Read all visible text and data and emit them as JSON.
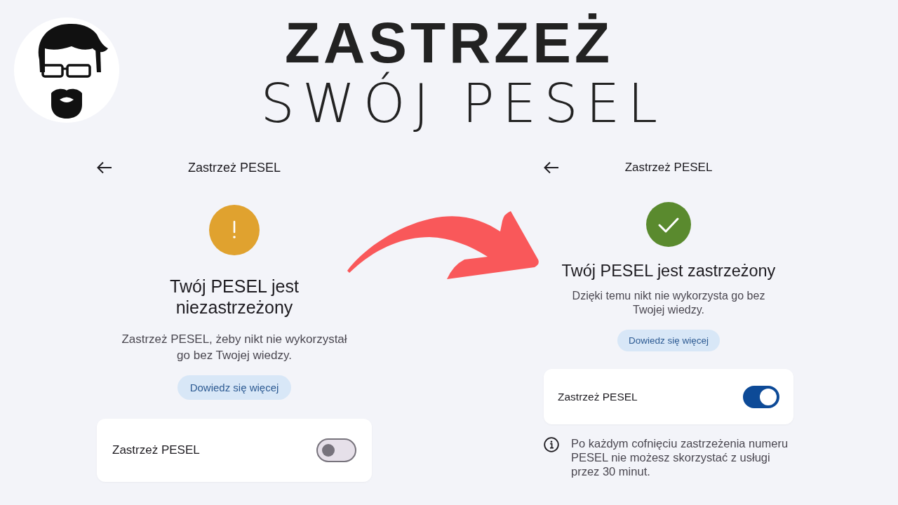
{
  "headline": {
    "line_1": "ZASTRZEŻ",
    "line_2": "SWÓJ PESEL"
  },
  "screens": [
    {
      "kind": "warning",
      "header_title": "Zastrzeż PESEL",
      "status_title": "Twój PESEL jest niezastrzeżony",
      "description": "Zastrzeż PESEL, żeby nikt nie wykorzystał go bez Twojej wiedzy.",
      "learn_more_button": "Dowiedz się więcej",
      "setting": {
        "label": "Zastrzeż PESEL",
        "on": false
      }
    },
    {
      "kind": "success",
      "header_title": "Zastrzeż PESEL",
      "status_title": "Twój PESEL jest zastrzeżony",
      "description": "Dzięki temu nikt nie wykorzysta go bez Twojej wiedzy.",
      "learn_more_button": "Dowiedz się więcej",
      "setting": {
        "label": "Zastrzeż PESEL",
        "on": true
      },
      "note": "Po każdym cofnięciu zastrzeżenia numeru PESEL nie możesz skorzystać z usługi przez 30 minut."
    }
  ]
}
